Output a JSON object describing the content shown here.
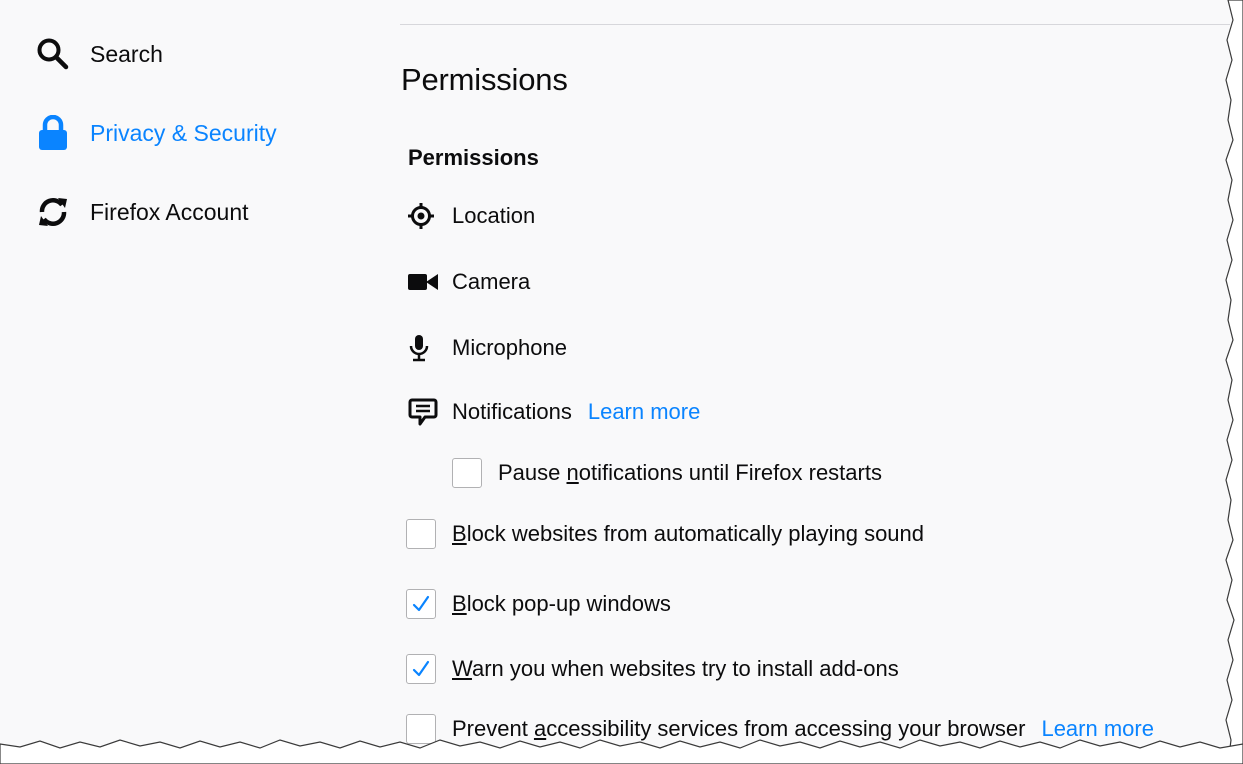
{
  "sidebar": {
    "items": [
      {
        "label": "Search",
        "icon": "search-icon",
        "active": false
      },
      {
        "label": "Privacy & Security",
        "icon": "lock-icon",
        "active": true
      },
      {
        "label": "Firefox Account",
        "icon": "sync-icon",
        "active": false
      }
    ]
  },
  "main": {
    "page_heading": "Permissions",
    "section_title": "Permissions",
    "permissions": [
      {
        "label": "Location",
        "icon": "location-target-icon"
      },
      {
        "label": "Camera",
        "icon": "camera-icon"
      },
      {
        "label": "Microphone",
        "icon": "microphone-icon"
      },
      {
        "label": "Notifications",
        "icon": "notification-bubble-icon",
        "link": "Learn more"
      }
    ],
    "checkboxes": [
      {
        "pre": "Pause ",
        "key": "n",
        "post": "otifications until Firefox restarts",
        "checked": false,
        "indented": true
      },
      {
        "pre": "",
        "key": "B",
        "post": "lock websites from automatically playing sound",
        "checked": false
      },
      {
        "pre": "",
        "key": "B",
        "post": "lock pop-up windows",
        "checked": true
      },
      {
        "pre": "",
        "key": "W",
        "post": "arn you when websites try to install add-ons",
        "checked": true
      },
      {
        "pre": "Prevent ",
        "key": "a",
        "post": "ccessibility services from accessing your browser",
        "checked": false,
        "link": "Learn more"
      }
    ]
  },
  "colors": {
    "accent": "#0a84ff",
    "text": "#0c0c0d",
    "background": "#f9f9fa",
    "checkbox_border": "#b1b1b3"
  }
}
